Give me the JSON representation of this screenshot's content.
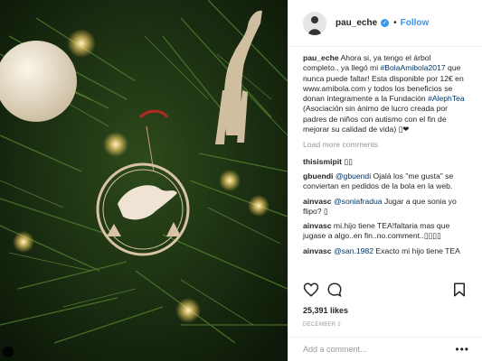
{
  "post": {
    "username": "pau_eche",
    "dot": "•",
    "follow_label": "Follow",
    "verified_glyph": "✓"
  },
  "caption": {
    "user": "pau_eche",
    "text1": " Ahora si, ya tengo el árbol completo.. ya llegó mi ",
    "tag1": "#BolaAmibola2017",
    "text2": " que nunca puede faltar! Esta disponible por 12€ en www.amibola.com y todos los beneficios se donan íntegramente a la Fundación ",
    "tag2": "#AlephTea",
    "text3": " (Asociación sin ánimo de lucro creada por padres de niños con autismo con el fin de mejorar su calidad de vida) ▯❤"
  },
  "load_more_label": "Load more comments",
  "comments": [
    {
      "user": "thisismipit",
      "mention": "",
      "text": " ▯▯"
    },
    {
      "user": "gbuendi",
      "mention": "@gbuendi",
      "text": " Ojalá los \"me gusta\" se conviertan en pedidos de la bola en la web."
    },
    {
      "user": "ainvasc",
      "mention": "@soniafradua",
      "text": " Jugar a que sonia yo flipo? ▯"
    },
    {
      "user": "ainvasc",
      "mention": "",
      "text": " mi.hijo tiene TEA!faltaria mas que jugase a algo..en fin..no.comment..▯▯▯▯"
    },
    {
      "user": "ainvasc",
      "mention": "@san.1982",
      "text": " Exacto mi hijo tiene TEA"
    }
  ],
  "likes_label": "25,391 likes",
  "date_label": "DECEMBER 2",
  "add_comment_placeholder": "Add a comment...",
  "more_glyph": "•••",
  "icons": [
    "heart-icon",
    "comment-icon",
    "bookmark-icon",
    "user-tag-icon",
    "verified-badge-icon"
  ],
  "colors": {
    "link": "#003569",
    "follow": "#3897f0",
    "muted": "#999999"
  }
}
